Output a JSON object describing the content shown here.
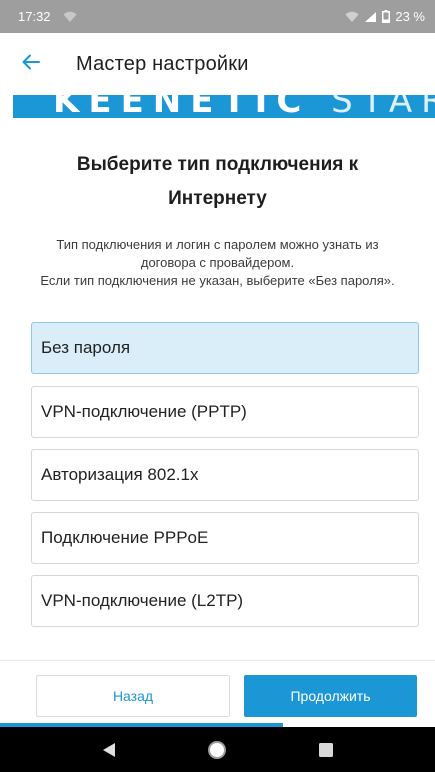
{
  "status_bar": {
    "time": "17:32",
    "battery": "23 %",
    "icons": [
      "wifi-icon",
      "signal-icon",
      "battery-icon"
    ]
  },
  "app_bar": {
    "title": "Мастер настройки",
    "back_icon": "arrow-left-icon"
  },
  "brand": {
    "text_bold": "KEENETIC",
    "text_light": "START"
  },
  "page": {
    "heading": "Выберите тип подключения к Интернету",
    "description_line1": "Тип подключения и логин с паролем можно узнать из договора с провайдером.",
    "description_line2": "Если тип подключения не указан, выберите «Без пароля»."
  },
  "options": [
    {
      "label": "Без пароля",
      "selected": true
    },
    {
      "label": "VPN-подключение (PPTP)",
      "selected": false
    },
    {
      "label": "Авторизация 802.1x",
      "selected": false
    },
    {
      "label": "Подключение PPPoE",
      "selected": false
    },
    {
      "label": "VPN-подключение (L2TP)",
      "selected": false
    }
  ],
  "buttons": {
    "back": "Назад",
    "next": "Продолжить"
  },
  "progress": {
    "fraction": 0.65
  },
  "colors": {
    "accent": "#1c97d6",
    "selected_bg": "#d9eef9",
    "status_bar": "#9e9e9e"
  },
  "nav_bar": {
    "icons": [
      "nav-back-icon",
      "nav-home-icon",
      "nav-recents-icon"
    ]
  }
}
